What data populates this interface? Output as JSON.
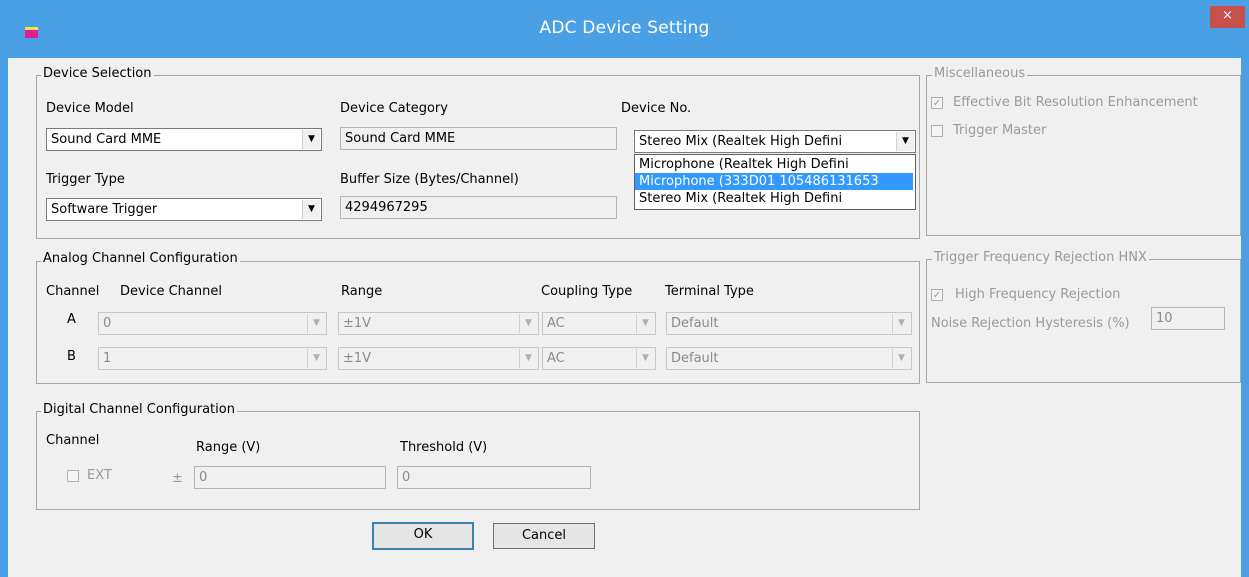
{
  "window": {
    "title": "ADC Device Setting",
    "close_glyph": "×"
  },
  "device_selection": {
    "title": "Device Selection",
    "device_model": {
      "label": "Device Model",
      "value": "Sound Card MME"
    },
    "device_category": {
      "label": "Device Category",
      "value": "Sound Card MME"
    },
    "device_no": {
      "label": "Device No.",
      "value": "Stereo Mix (Realtek High Defini",
      "options": [
        "Microphone (Realtek High Defini",
        "Microphone (333D01 105486131653",
        "Stereo Mix (Realtek High Defini"
      ],
      "highlighted_index": 1
    },
    "trigger_type": {
      "label": "Trigger Type",
      "value": "Software Trigger"
    },
    "buffer_size": {
      "label": "Buffer Size (Bytes/Channel)",
      "value": "4294967295"
    }
  },
  "miscellaneous": {
    "title": "Miscellaneous",
    "ebre": {
      "label": "Effective Bit Resolution Enhancement",
      "checked": true
    },
    "trigger_master": {
      "label": "Trigger Master",
      "checked": false
    }
  },
  "analog": {
    "title": "Analog Channel Configuration",
    "headers": {
      "channel": "Channel",
      "device_channel": "Device Channel",
      "range": "Range",
      "coupling": "Coupling Type",
      "terminal": "Terminal Type"
    },
    "rows": [
      {
        "channel": "A",
        "device_channel": "0",
        "range": "±1V",
        "coupling": "AC",
        "terminal": "Default"
      },
      {
        "channel": "B",
        "device_channel": "1",
        "range": "±1V",
        "coupling": "AC",
        "terminal": "Default"
      }
    ]
  },
  "trigger_freq": {
    "title": "Trigger Frequency Rejection HNX",
    "hfr": {
      "label": "High Frequency Rejection",
      "checked": true
    },
    "noise_label": "Noise Rejection Hysteresis (%)",
    "noise_value": "10"
  },
  "digital": {
    "title": "Digital Channel Configuration",
    "channel_label": "Channel",
    "range_label": "Range (V)",
    "threshold_label": "Threshold (V)",
    "ext": {
      "label": "EXT",
      "checked": false
    },
    "pm": "±",
    "range_value": "0",
    "threshold_value": "0"
  },
  "buttons": {
    "ok": "OK",
    "cancel": "Cancel"
  }
}
